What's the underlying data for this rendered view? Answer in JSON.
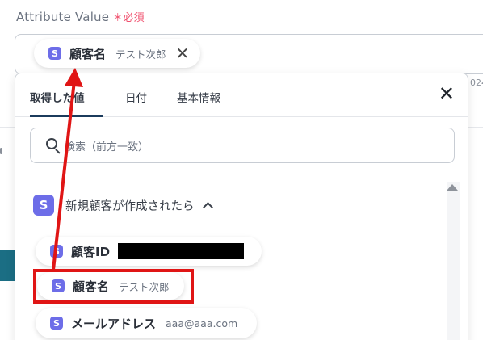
{
  "field": {
    "label": "Attribute Value",
    "required_mark": "＊必須",
    "background_date_fragment": "024"
  },
  "selected_chip": {
    "badge": "S",
    "label": "顧客名",
    "value": "テスト次郎",
    "close_icon": "close-icon"
  },
  "panel": {
    "tabs": [
      {
        "label": "取得した値",
        "active": true
      },
      {
        "label": "日付",
        "active": false
      },
      {
        "label": "基本情報",
        "active": false
      }
    ],
    "close_icon": "close-icon",
    "search": {
      "placeholder": "検索（前方一致）"
    },
    "group": {
      "badge": "S",
      "label": "新規顧客が作成されたら",
      "expanded": true
    },
    "items": [
      {
        "badge": "S",
        "label": "顧客ID",
        "value": "",
        "redacted": true
      },
      {
        "badge": "S",
        "label": "顧客名",
        "value": "テスト次郎",
        "highlighted": true
      },
      {
        "badge": "S",
        "label": "メールアドレス",
        "value": "aaa@aaa.com"
      }
    ]
  },
  "colors": {
    "badge": "#6d6de8",
    "required": "#f0506e",
    "annotation_red": "#e01515",
    "tab_underline": "#1b3b5c",
    "side_button": "#1b6e84"
  }
}
